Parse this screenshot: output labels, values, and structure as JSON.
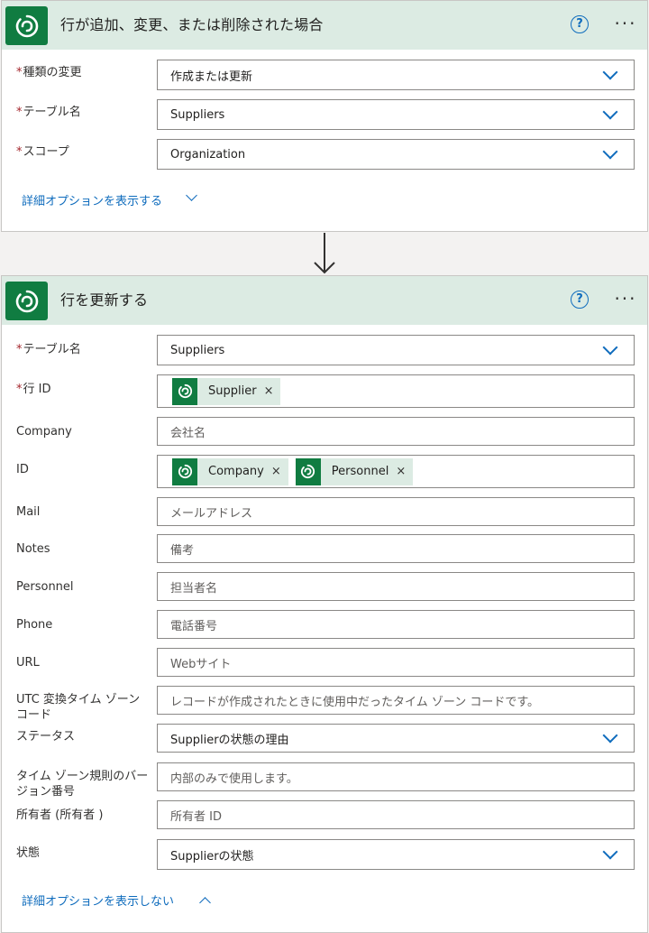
{
  "trigger": {
    "title": "行が追加、変更、または削除された場合",
    "fields": [
      {
        "label": "種類の変更",
        "value": "作成または更新",
        "required": true
      },
      {
        "label": "テーブル名",
        "value": "Suppliers",
        "required": true
      },
      {
        "label": "スコープ",
        "value": "Organization",
        "required": true
      }
    ],
    "advanced_link": "詳細オプションを表示する"
  },
  "action": {
    "title": "行を更新する",
    "table": {
      "label": "テーブル名",
      "value": "Suppliers"
    },
    "row_id": {
      "label": "行 ID",
      "tokens": [
        "Supplier"
      ]
    },
    "company": {
      "label": "Company",
      "placeholder": "会社名"
    },
    "id": {
      "label": "ID",
      "tokens": [
        "Company",
        "Personnel"
      ]
    },
    "mail": {
      "label": "Mail",
      "placeholder": "メールアドレス"
    },
    "notes": {
      "label": "Notes",
      "placeholder": "備考"
    },
    "personnel": {
      "label": "Personnel",
      "placeholder": "担当者名"
    },
    "phone": {
      "label": "Phone",
      "placeholder": "電話番号"
    },
    "url": {
      "label": "URL",
      "placeholder": "Webサイト"
    },
    "utc": {
      "label": "UTC 変換タイム ゾーン コード",
      "placeholder": "レコードが作成されたときに使用中だったタイム ゾーン コードです。"
    },
    "status_reason": {
      "label": "ステータス",
      "value": "Supplierの状態の理由"
    },
    "tz_rule": {
      "label": "タイム ゾーン規則のバージョン番号",
      "placeholder": "内部のみで使用します。"
    },
    "owner": {
      "label": "所有者 (所有者 )",
      "placeholder": "所有者 ID"
    },
    "state": {
      "label": "状態",
      "value": "Supplierの状態"
    },
    "advanced_link": "詳細オプションを表示しない"
  },
  "icons": {
    "dataverse": "dataverse-icon",
    "help": "help-icon",
    "more": "more-icon"
  },
  "colors": {
    "accent": "#0f6cbd",
    "header_bg": "#dcebe3",
    "brand_green": "#107c41",
    "required": "#a4262c"
  }
}
